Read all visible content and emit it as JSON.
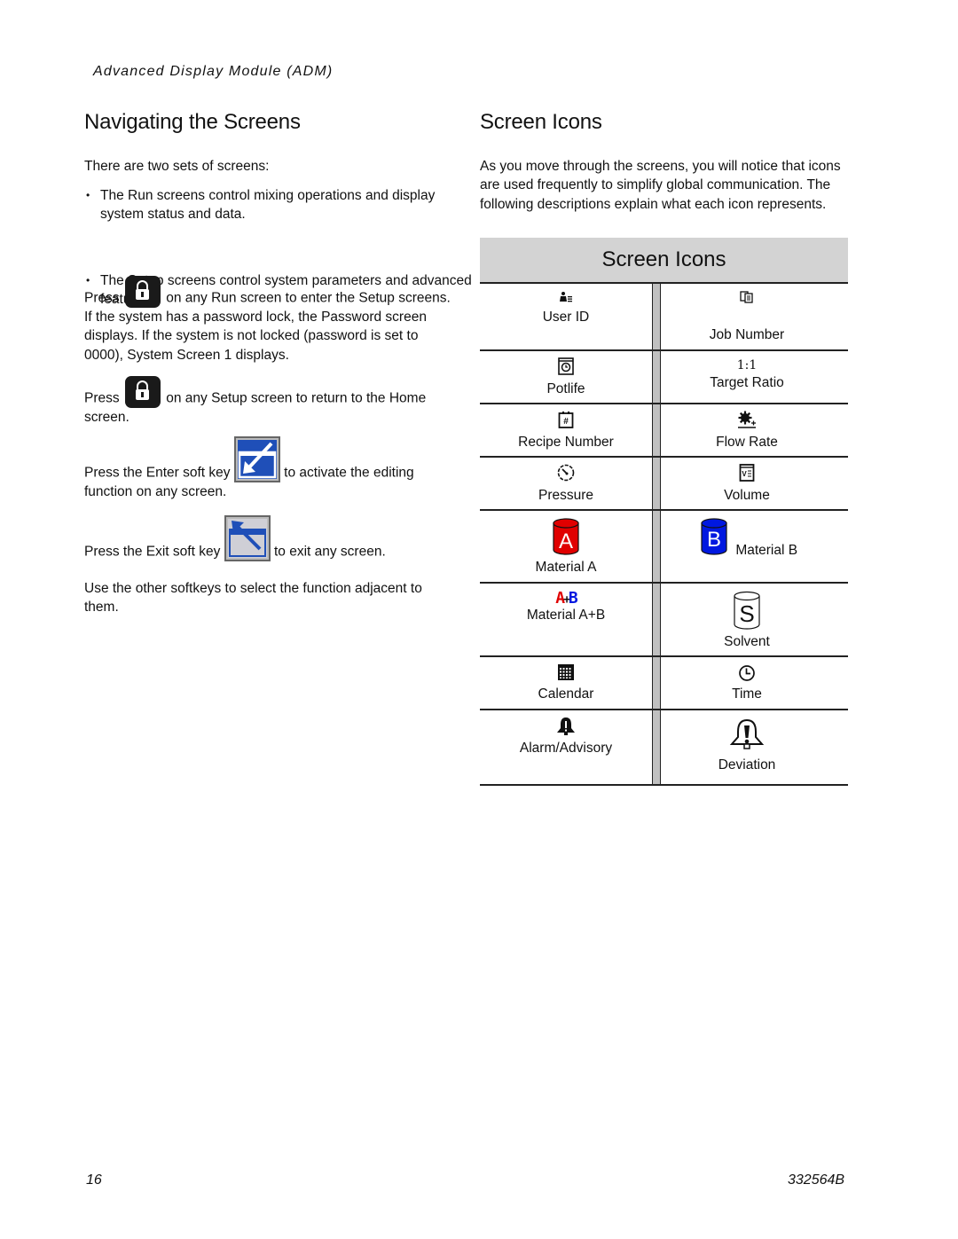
{
  "running_head": "Advanced Display Module (ADM)",
  "left": {
    "title": "Navigating the Screens",
    "intro": "There are two sets of screens:",
    "bullets": [
      "The Run screens control mixing operations and display system status and data.",
      "The Setup screens control system parameters and advanced features."
    ],
    "setup_press_prefix": "Press",
    "setup_press_text": "on any Run screen to enter the Setup screens.  If the system has a password lock, the Password screen displays. If the system is not locked (password is set to 0000), System Screen 1 displays.",
    "home_press_prefix": "Press",
    "home_press_text": "on any Setup screen to return to the Home screen.",
    "enter_prefix": "Press the Enter soft key",
    "enter_suffix": "to activate the editing function on any screen.",
    "exit_prefix": "Press the Exit soft key",
    "exit_suffix": "to exit any screen.",
    "softkeys_note": "Use the other softkeys to select the function adjacent to them.",
    "icons": {
      "lock_key": "lock-icon",
      "enter_key": "enter-arrow-icon",
      "exit_key": "exit-arrow-icon"
    }
  },
  "right": {
    "title": "Screen Icons",
    "intro": "As you move through the screens, you will notice that icons are used frequently to simplify global communication. The following descriptions explain what each icon represents.",
    "table": {
      "header": "Screen Icons",
      "rows": [
        [
          {
            "label": "User ID",
            "icon": "user-id-icon"
          },
          {
            "label": "Job Number",
            "icon": "job-number-icon"
          }
        ],
        [
          {
            "label": "Potlife",
            "icon": "potlife-icon"
          },
          {
            "label": "Target Ratio",
            "icon": "target-ratio-icon",
            "glyph": "1:1"
          }
        ],
        [
          {
            "label": "Recipe Number",
            "icon": "recipe-number-icon"
          },
          {
            "label": "Flow Rate",
            "icon": "flow-rate-icon"
          }
        ],
        [
          {
            "label": "Pressure",
            "icon": "pressure-icon"
          },
          {
            "label": "Volume",
            "icon": "volume-icon"
          }
        ],
        [
          {
            "label": "Material  A",
            "icon": "material-a-icon",
            "glyph": "A"
          },
          {
            "label": "Material  B",
            "icon": "material-b-icon",
            "glyph": "B"
          }
        ],
        [
          {
            "label": "Material  A+B",
            "icon": "material-a-plus-b-icon",
            "glyph_a": "A",
            "glyph_plus": "+",
            "glyph_b": "B"
          },
          {
            "label": "Solvent",
            "icon": "solvent-icon",
            "glyph": "S"
          }
        ],
        [
          {
            "label": "Calendar",
            "icon": "calendar-icon"
          },
          {
            "label": "Time",
            "icon": "time-icon"
          }
        ],
        [
          {
            "label": "Alarm/Advisory",
            "icon": "alarm-advisory-icon"
          },
          {
            "label": "Deviation",
            "icon": "deviation-icon"
          }
        ]
      ]
    },
    "colors": {
      "material_a": "#e00000",
      "material_b": "#0018e0",
      "enter_key_blue": "#1f4fb8",
      "header_gray": "#d3d3d3"
    }
  },
  "footer": {
    "page_number": "16",
    "doc_number": "332564B"
  }
}
